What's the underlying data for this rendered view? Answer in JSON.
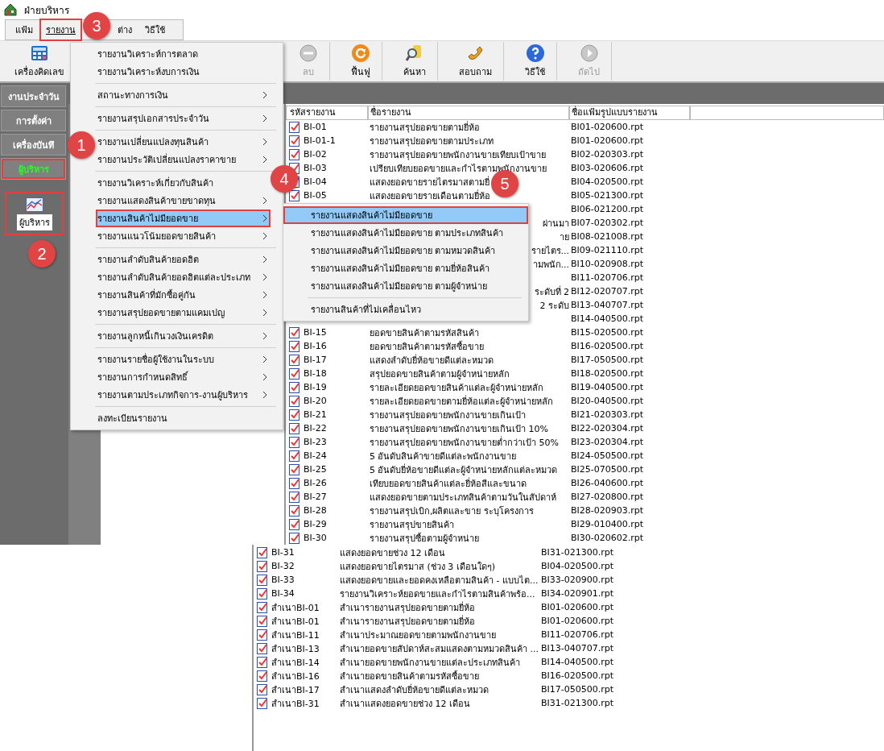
{
  "window": {
    "title": "ฝ่ายบริหาร"
  },
  "menu_bar": [
    {
      "label": "แฟ้ม",
      "selected": false
    },
    {
      "label": "รายงาน",
      "selected": true
    },
    {
      "label": "ต่าง",
      "selected": false
    },
    {
      "label": "วิธีใช้",
      "selected": false
    }
  ],
  "toolbar": {
    "left": [
      {
        "label": "เครื่องคิดเลข",
        "kind": "calculator",
        "disabled": false
      }
    ],
    "right": [
      {
        "label": "ลบ",
        "kind": "delete",
        "disabled": true
      },
      {
        "label": "ฟื้นฟู",
        "kind": "refresh",
        "disabled": false
      },
      {
        "label": "ค้นหา",
        "kind": "search",
        "disabled": false
      },
      {
        "label": "สอบถาม",
        "kind": "phone",
        "disabled": false
      },
      {
        "label": "วิธีใช้",
        "kind": "help",
        "disabled": false
      },
      {
        "label": "ถัดไป",
        "kind": "next",
        "disabled": true
      }
    ]
  },
  "sidebar": {
    "items": [
      {
        "label": "งานประจำวัน",
        "selected": false
      },
      {
        "label": "การตั้งค่า",
        "selected": false
      },
      {
        "label": "เครื่องบันทึ",
        "selected": false
      },
      {
        "label": "ผู้บริหาร",
        "selected": true
      }
    ],
    "panel": {
      "label": "ผู้บริหาร",
      "highlighted": true
    }
  },
  "report_menu": {
    "groups": [
      [
        {
          "label": "รายงานวิเคราะห์การตลาด",
          "has_submenu": false,
          "selected": false
        },
        {
          "label": "รายงานวิเคราะห์งบการเงิน",
          "has_submenu": false,
          "selected": false
        }
      ],
      [
        {
          "label": "สถานะทางการเงิน",
          "has_submenu": true,
          "selected": false
        }
      ],
      [
        {
          "label": "รายงานสรุปเอกสารประจำวัน",
          "has_submenu": true,
          "selected": false
        }
      ],
      [
        {
          "label": "รายงานเปลี่ยนแปลงทุนสินค้า",
          "has_submenu": true,
          "selected": false
        },
        {
          "label": "รายงานประวัติเปลี่ยนแปลงราคาขาย",
          "has_submenu": true,
          "selected": false
        }
      ],
      [
        {
          "label": "รายงานวิเคราะห์เกี่ยวกับสินค้า",
          "has_submenu": false,
          "selected": false
        },
        {
          "label": "รายงานแสดงสินค้าขายขาดทุน",
          "has_submenu": true,
          "selected": false
        },
        {
          "label": "รายงานสินค้าไม่มียอดขาย",
          "has_submenu": true,
          "selected": true
        },
        {
          "label": "รายงานแนวโน้มยอดขายสินค้า",
          "has_submenu": true,
          "selected": false
        }
      ],
      [
        {
          "label": "รายงานลำดับสินค้ายอดฮิต",
          "has_submenu": true,
          "selected": false
        },
        {
          "label": "รายงานลำดับสินค้ายอดฮิตแต่ละประเภท",
          "has_submenu": true,
          "selected": false
        },
        {
          "label": "รายงานสินค้าที่มักซื้อคู่กัน",
          "has_submenu": true,
          "selected": false
        },
        {
          "label": "รายงานสรุปยอดขายตามแคมเปญ",
          "has_submenu": true,
          "selected": false
        }
      ],
      [
        {
          "label": "รายงานลูกหนี้เกินวงเงินเครดิต",
          "has_submenu": true,
          "selected": false
        }
      ],
      [
        {
          "label": "รายงานรายชื่อผู้ใช้งานในระบบ",
          "has_submenu": true,
          "selected": false
        },
        {
          "label": "รายงานการกำหนดสิทธิ์",
          "has_submenu": true,
          "selected": false
        },
        {
          "label": "รายงานตามประเภทกิจการ-งานผู้บริหาร",
          "has_submenu": true,
          "selected": false
        }
      ],
      [
        {
          "label": "ลงทะเบียนรายงาน",
          "has_submenu": false,
          "selected": false
        }
      ]
    ]
  },
  "submenu": {
    "groups": [
      [
        {
          "label": "รายงานแสดงสินค้าไม่มียอดขาย",
          "selected": true
        },
        {
          "label": "รายงานแสดงสินค้าไม่มียอดขาย ตามประเภทสินค้า",
          "selected": false
        },
        {
          "label": "รายงานแสดงสินค้าไม่มียอดขาย ตามหมวดสินค้า",
          "selected": false
        },
        {
          "label": "รายงานแสดงสินค้าไม่มียอดขาย ตามยี่ห้อสินค้า",
          "selected": false
        },
        {
          "label": "รายงานแสดงสินค้าไม่มียอดขาย ตามผู้จำหน่าย",
          "selected": false
        }
      ],
      [
        {
          "label": "รายงานสินค้าที่ไม่เคลื่อนไหว",
          "selected": false
        }
      ]
    ]
  },
  "report_list": {
    "columns": [
      "รหัสรายงาน",
      "ชื่อรายงาน",
      "ชื่อแฟ้มรูปแบบรายงาน"
    ],
    "rows": [
      {
        "code": "BI-01",
        "name": "รายงานสรุปยอดขายตามยี่ห้อ",
        "file": "BI01-020600.rpt"
      },
      {
        "code": "BI-01-1",
        "name": "รายงานสรุปยอดขายตามประเภท",
        "file": "BI01-020600.rpt"
      },
      {
        "code": "BI-02",
        "name": "รายงานสรุปยอดขายพนักงานขายเทียบเป้าขาย",
        "file": "BI02-020303.rpt"
      },
      {
        "code": "BI-03",
        "name": "เปรียบเทียบยอดขายและกำไรตามพนักงานขาย",
        "file": "BI03-020606.rpt"
      },
      {
        "code": "BI-04",
        "name": "แสดงยอดขายรายไตรมาสตามยี่",
        "file": "BI04-020500.rpt"
      },
      {
        "code": "BI-05",
        "name": "แสดงยอดขายรายเดือนตามยี่ห้อ",
        "file": "BI05-021300.rpt"
      },
      {
        "file": "BI06-021200.rpt"
      },
      {
        "name": "ผ่านมา",
        "file": "BI07-020302.rpt"
      },
      {
        "name": "าย",
        "file": "BI08-021008.rpt"
      },
      {
        "name": "รายไตร...",
        "file": "BI09-021110.rpt"
      },
      {
        "name": "ามพนัก...",
        "file": "BI10-020908.rpt"
      },
      {
        "file": "BI11-020706.rpt"
      },
      {
        "name": "ระดับที่ 2",
        "file": "BI12-020707.rpt"
      },
      {
        "name": "2 ระดับ",
        "file": "BI13-040707.rpt"
      },
      {
        "file": "BI14-040500.rpt"
      },
      {
        "code": "BI-15",
        "name": "ยอดขายสินค้าตามรหัสสินค้า",
        "file": "BI15-020500.rpt"
      },
      {
        "code": "BI-16",
        "name": "ยอดขายสินค้าตามรหัสซื้อขาย",
        "file": "BI16-020500.rpt"
      },
      {
        "code": "BI-17",
        "name": "แสดงลำดับยี่ห้อขายดีแต่ละหมวด",
        "file": "BI17-050500.rpt"
      },
      {
        "code": "BI-18",
        "name": "สรุปยอดขายสินค้าตามผู้จำหน่ายหลัก",
        "file": "BI18-020500.rpt"
      },
      {
        "code": "BI-19",
        "name": "รายละเอียดยอดขายสินค้าแต่ละผู้จำหน่ายหลัก",
        "file": "BI19-040500.rpt"
      },
      {
        "code": "BI-20",
        "name": "รายละเอียดยอดขายตามยี่ห้อแต่ละผู้จำหน่ายหลัก",
        "file": "BI20-040500.rpt"
      },
      {
        "code": "BI-21",
        "name": "รายงานสรุปยอดขายพนักงานขายเกินเป้า",
        "file": "BI21-020303.rpt"
      },
      {
        "code": "BI-22",
        "name": "รายงานสรุปยอดขายพนักงานขายเกินเป้า 10%",
        "file": "BI22-020304.rpt"
      },
      {
        "code": "BI-23",
        "name": "รายงานสรุปยอดขายพนักงานขายต่ำกว่าเป้า 50%",
        "file": "BI23-020304.rpt"
      },
      {
        "code": "BI-24",
        "name": "5 อันดับสินค้าขายดีแต่ละพนักงานขาย",
        "file": "BI24-050500.rpt"
      },
      {
        "code": "BI-25",
        "name": "5 อันดับยี่ห้อขายดีแต่ละผู้จำหน่ายหลักแต่ละหมวด",
        "file": "BI25-070500.rpt"
      },
      {
        "code": "BI-26",
        "name": "เทียบยอดขายสินค้าแต่ละยี่ห้อสีและขนาด",
        "file": "BI26-040600.rpt"
      },
      {
        "code": "BI-27",
        "name": "แสดงยอดขายตามประเภทสินค้าตามวันในสัปดาห์",
        "file": "BI27-020800.rpt"
      },
      {
        "code": "BI-28",
        "name": "รายงานสรุปเบิก,ผลิตและขาย ระบุโครงการ",
        "file": "BI28-020903.rpt"
      },
      {
        "code": "BI-29",
        "name": "รายงานสรุปขายสินค้า",
        "file": "BI29-010400.rpt"
      },
      {
        "code": "BI-30",
        "name": "รายงานสรุปซื้อตามผู้จำหน่าย",
        "file": "BI30-020602.rpt"
      }
    ]
  },
  "report_list_continued": {
    "rows": [
      {
        "code": "BI-31",
        "name": "แสดงยอดขายช่วง 12 เดือน",
        "file": "BI31-021300.rpt"
      },
      {
        "code": "BI-32",
        "name": "แสดงยอดขายไตรมาส (ช่วง 3 เดือนใดๆ)",
        "file": "BI04-020500.rpt"
      },
      {
        "code": "BI-33",
        "name": "แสดงยอดขายและยอดคงเหลือตามสินค้า - แบบไต...",
        "file": "BI33-020900.rpt"
      },
      {
        "code": "BI-34",
        "name": "รายงานวิเคราะห์ยอดขายและกำไรตามสินค้าพร้อ...",
        "file": "BI34-020901.rpt"
      },
      {
        "code": "สำเนาBI-01",
        "name": "สำเนารายงานสรุปยอดขายตามยี่ห้อ",
        "file": "BI01-020600.rpt"
      },
      {
        "code": "สำเนาBI-01",
        "name": "สำเนารายงานสรุปยอดขายตามยี่ห้อ",
        "file": "BI01-020600.rpt"
      },
      {
        "code": "สำเนาBI-11",
        "name": "สำเนาประมาณยอดขายตามพนักงานขาย",
        "file": "BI11-020706.rpt"
      },
      {
        "code": "สำเนาBI-13",
        "name": "สำเนายอดขายสัปดาห์สะสมแสดงตามหมวดสินค้า ...",
        "file": "BI13-040707.rpt"
      },
      {
        "code": "สำเนาBI-14",
        "name": "สำเนายอดขายพนักงานขายแต่ละประเภทสินค้า",
        "file": "BI14-040500.rpt"
      },
      {
        "code": "สำเนาBI-16",
        "name": "สำเนายอดขายสินค้าตามรหัสซื้อขาย",
        "file": "BI16-020500.rpt"
      },
      {
        "code": "สำเนาBI-17",
        "name": "สำเนาแสดงลำดับยี่ห้อขายดีแต่ละหมวด",
        "file": "BI17-050500.rpt"
      },
      {
        "code": "สำเนาBI-31",
        "name": "สำเนาแสดงยอดขายช่วง 12 เดือน",
        "file": "BI31-021300.rpt"
      }
    ]
  },
  "annotations": [
    {
      "number": "1"
    },
    {
      "number": "2"
    },
    {
      "number": "3"
    },
    {
      "number": "4"
    },
    {
      "number": "5"
    }
  ]
}
